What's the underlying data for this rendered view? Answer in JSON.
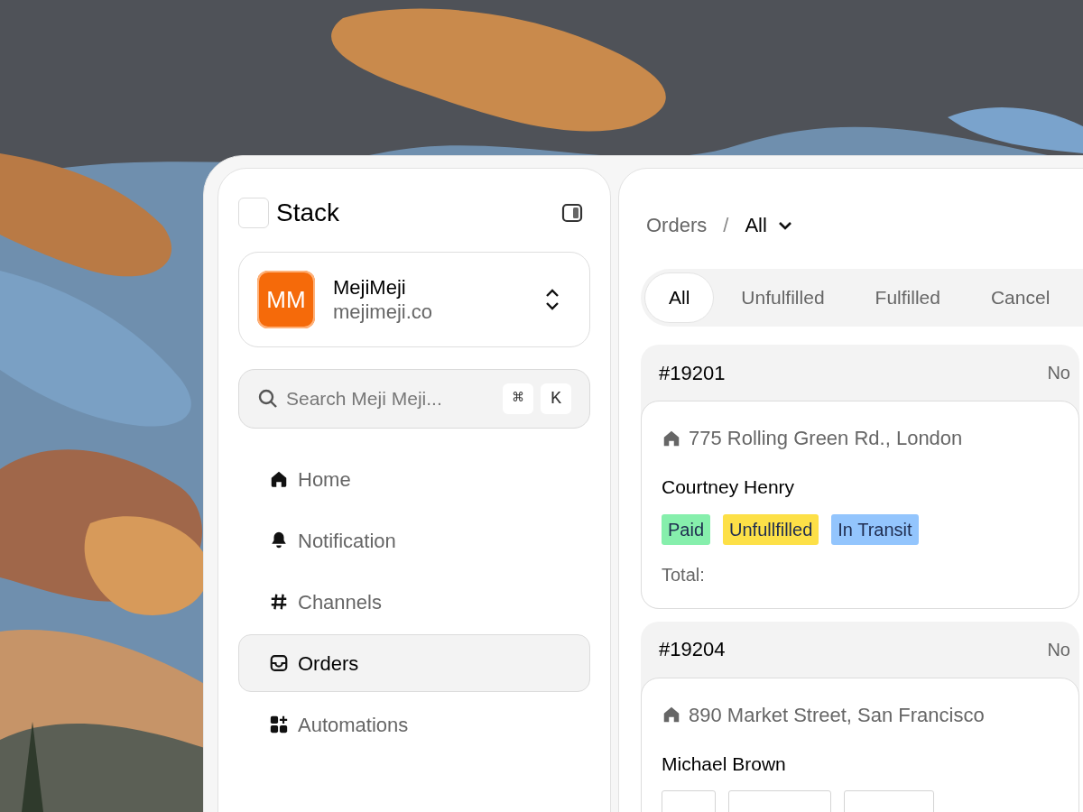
{
  "sidebar": {
    "brand": "Stack",
    "workspace": {
      "initials": "MM",
      "name": "MejiMeji",
      "domain": "mejimeji.co"
    },
    "search": {
      "placeholder": "Search Meji Meji...",
      "keys": [
        "⌘",
        "K"
      ]
    },
    "items": [
      {
        "label": "Home",
        "kind": "home",
        "selected": false
      },
      {
        "label": "Notification",
        "kind": "bell",
        "selected": false
      },
      {
        "label": "Channels",
        "kind": "hash",
        "selected": false
      },
      {
        "label": "Orders",
        "kind": "inbox",
        "selected": true
      },
      {
        "label": "Automations",
        "kind": "apps",
        "selected": false
      }
    ]
  },
  "main": {
    "breadcrumb": {
      "parent": "Orders",
      "separator": "/",
      "current": "All"
    },
    "tabs": [
      {
        "label": "All",
        "selected": true
      },
      {
        "label": "Unfulfilled",
        "selected": false
      },
      {
        "label": "Fulfilled",
        "selected": false
      },
      {
        "label": "Cancel",
        "selected": false
      }
    ],
    "orders": [
      {
        "number": "#19201",
        "status": "No",
        "address": "775 Rolling Green Rd., London",
        "customer": "Courtney Henry",
        "tags": [
          {
            "label": "Paid",
            "color": "#86efac"
          },
          {
            "label": "Unfullfilled",
            "color": "#fde047"
          },
          {
            "label": "In Transit",
            "color": "#93c5fd"
          }
        ],
        "total_label": "Total:",
        "tags_cut": false
      },
      {
        "number": "#19204",
        "status": "No",
        "address": "890 Market Street, San Francisco",
        "customer": "Michael Brown",
        "tags_cut": true
      }
    ]
  }
}
